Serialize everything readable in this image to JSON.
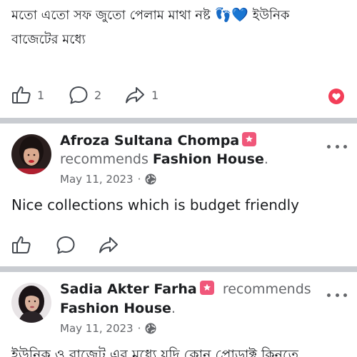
{
  "previous_post": {
    "text_line1": "মতো এতো সফ জুতো পেলাম মাথা নষ্ট",
    "text_emoji": "👣💙",
    "text_line1_end": "ইউনিক",
    "text_line2": "বাজেটের মধ্যে",
    "like_count": "1",
    "comment_count": "2",
    "share_count": "1",
    "reaction": "love-icon"
  },
  "posts": [
    {
      "author": "Afroza Sultana Chompa",
      "verb": "recommends",
      "page": "Fashion House",
      "period": ".",
      "date": "May 11, 2023",
      "separator": "·",
      "privacy_icon": "globe-icon",
      "text": "Nice collections which is budget friendly"
    },
    {
      "author": "Sadia Akter Farha",
      "verb": "recommends",
      "page": "Fashion House",
      "period": ".",
      "date": "May 11, 2023",
      "separator": "·",
      "privacy_icon": "globe-icon",
      "text": "ইউনিক ও বাজেট এর মধ্যে যদি কোন প্রোডাক্ট কিনতে"
    }
  ],
  "colors": {
    "divider": "#c9ccd1",
    "muted": "#65676b",
    "badge": "#f0577a",
    "love": "#f33e58"
  }
}
